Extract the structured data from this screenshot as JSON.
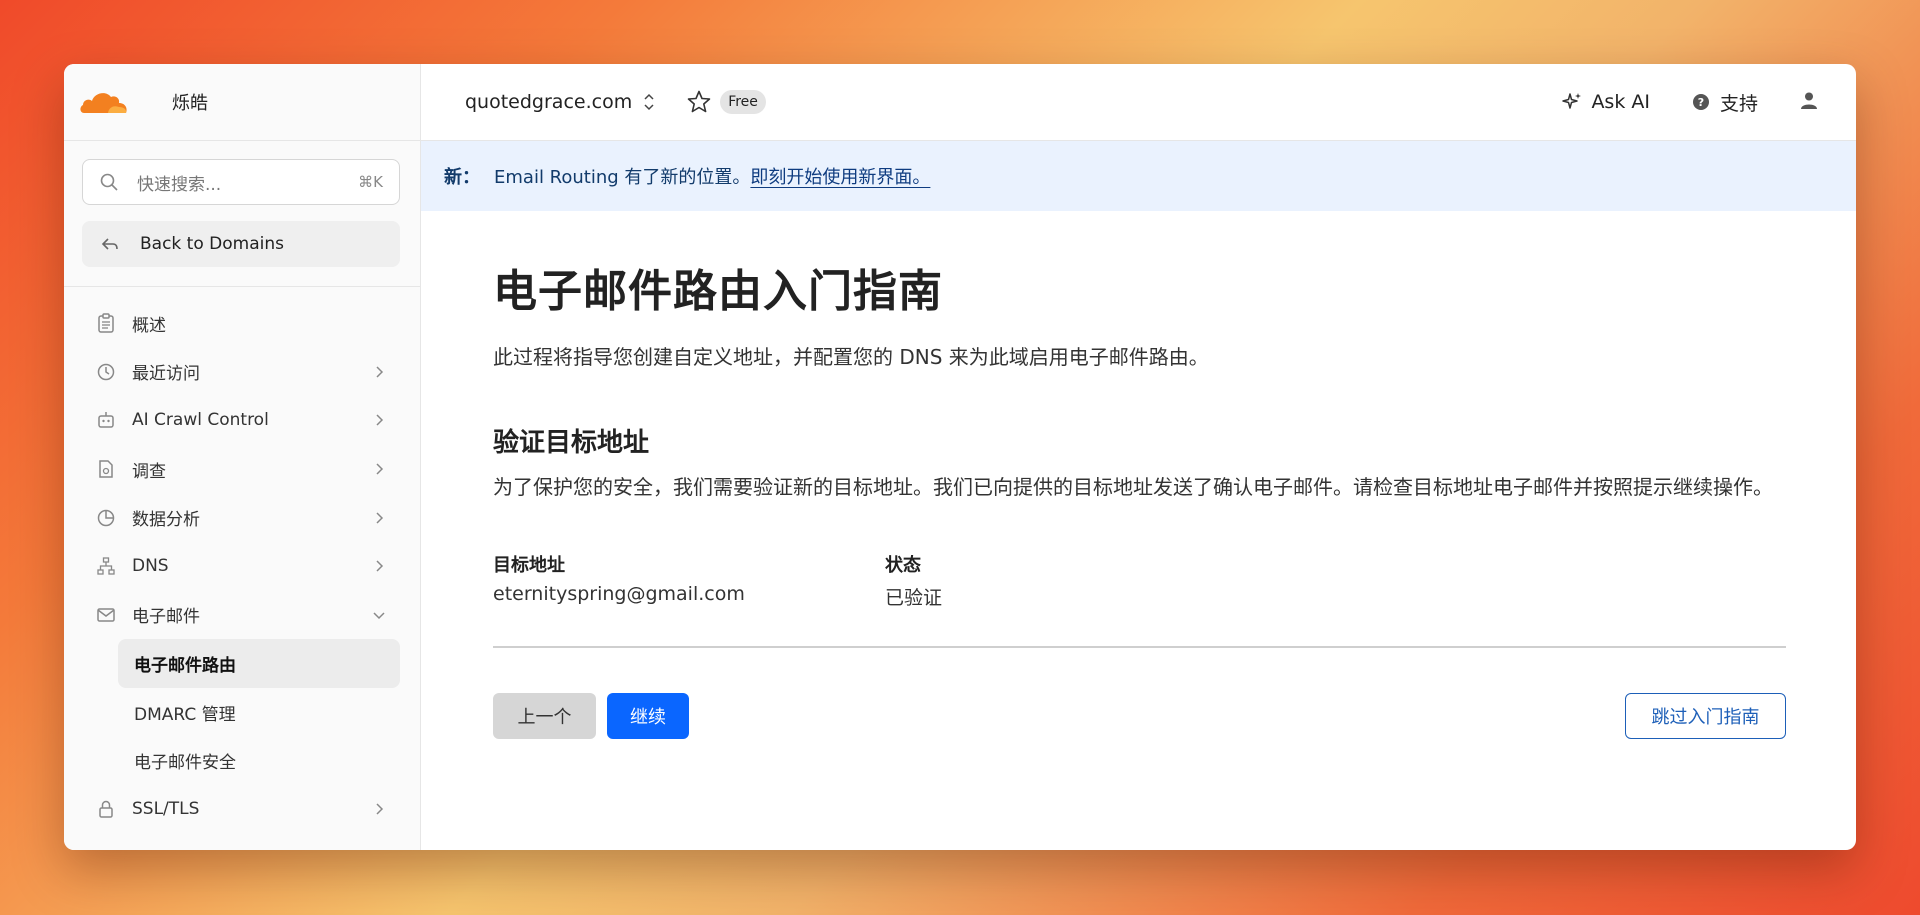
{
  "sidebar": {
    "account_name": "烁皓",
    "search_placeholder": "快速搜索...",
    "search_shortcut": "⌘K",
    "back_label": "Back to Domains",
    "items": [
      {
        "label": "概述",
        "icon": "clipboard-icon"
      },
      {
        "label": "最近访问",
        "icon": "history-icon"
      },
      {
        "label": "AI Crawl Control",
        "icon": "robot-icon"
      },
      {
        "label": "调查",
        "icon": "investigate-icon"
      },
      {
        "label": "数据分析",
        "icon": "pie-chart-icon"
      },
      {
        "label": "DNS",
        "icon": "network-icon"
      },
      {
        "label": "电子邮件",
        "icon": "mail-icon"
      },
      {
        "label": "SSL/TLS",
        "icon": "lock-icon"
      }
    ],
    "sub_items": [
      "电子邮件路由",
      "DMARC 管理",
      "电子邮件安全"
    ]
  },
  "topbar": {
    "domain": "quotedgrace.com",
    "plan_badge": "Free",
    "ask_ai": "Ask AI",
    "support": "支持"
  },
  "banner": {
    "prefix": "新：",
    "text": "Email Routing 有了新的位置。",
    "link": "即刻开始使用新界面。"
  },
  "main": {
    "title": "电子邮件路由入门指南",
    "description": "此过程将指导您创建自定义地址，并配置您的 DNS 来为此域启用电子邮件路由。",
    "section_title": "验证目标地址",
    "section_text": "为了保护您的安全，我们需要验证新的目标地址。我们已向提供的目标地址发送了确认电子邮件。请检查目标地址电子邮件并按照提示继续操作。",
    "fields": [
      {
        "label": "目标地址",
        "value": "eternityspring@gmail.com"
      },
      {
        "label": "状态",
        "value": "已验证"
      }
    ],
    "buttons": {
      "prev": "上一个",
      "next": "继续",
      "skip": "跳过入门指南"
    }
  },
  "colors": {
    "accent": "#0a66ff",
    "brand": "#f38020",
    "banner_bg": "#eaf2fe"
  }
}
